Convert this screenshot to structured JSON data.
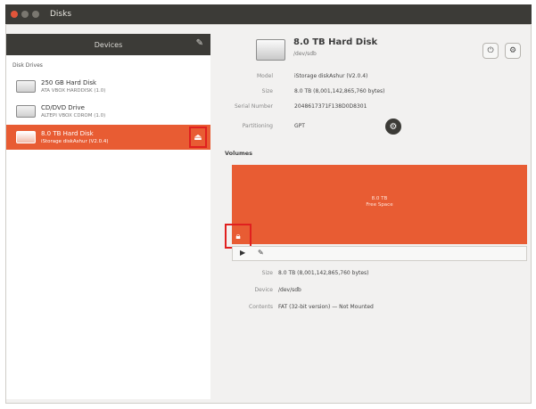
{
  "window": {
    "title": "Disks"
  },
  "sidebar": {
    "header_label": "Devices",
    "section_label": "Disk Drives",
    "devices": [
      {
        "name": "250 GB Hard Disk",
        "sub": "ATA VBOX HARDDISK (1.0)"
      },
      {
        "name": "CD/DVD Drive",
        "sub": "ALTEPI VBOX CDROM (1.0)"
      },
      {
        "name": "8.0 TB Hard Disk",
        "sub": "iStorage diskAshur (V2.0.4)"
      }
    ]
  },
  "disk": {
    "title": "8.0 TB Hard Disk",
    "subtitle": "/dev/sdb",
    "properties": [
      {
        "label": "Model",
        "value": "iStorage diskAshur (V2.0.4)"
      },
      {
        "label": "Size",
        "value": "8.0 TB (8,001,142,865,760 bytes)"
      },
      {
        "label": "Serial Number",
        "value": "2048617371F138D0D8301"
      },
      {
        "label": "Partitioning",
        "value": "GPT"
      }
    ]
  },
  "volumes": {
    "label": "Volumes",
    "block_line1": "8.0 TB",
    "block_line2": "Free Space",
    "details": [
      {
        "label": "Size",
        "value": "8.0 TB (8,001,142,865,760 bytes)"
      },
      {
        "label": "Device",
        "value": "/dev/sdb"
      },
      {
        "label": "Contents",
        "value": "FAT (32-bit version) — Not Mounted"
      }
    ]
  },
  "icons": {
    "power": "power-icon",
    "menu": "gear-icon",
    "eject": "eject-icon",
    "play": "play-icon",
    "settings": "wrench-icon"
  },
  "colors": {
    "accent": "#e85c33",
    "highlight": "#e0201f",
    "titlebar": "#3c3b37"
  }
}
